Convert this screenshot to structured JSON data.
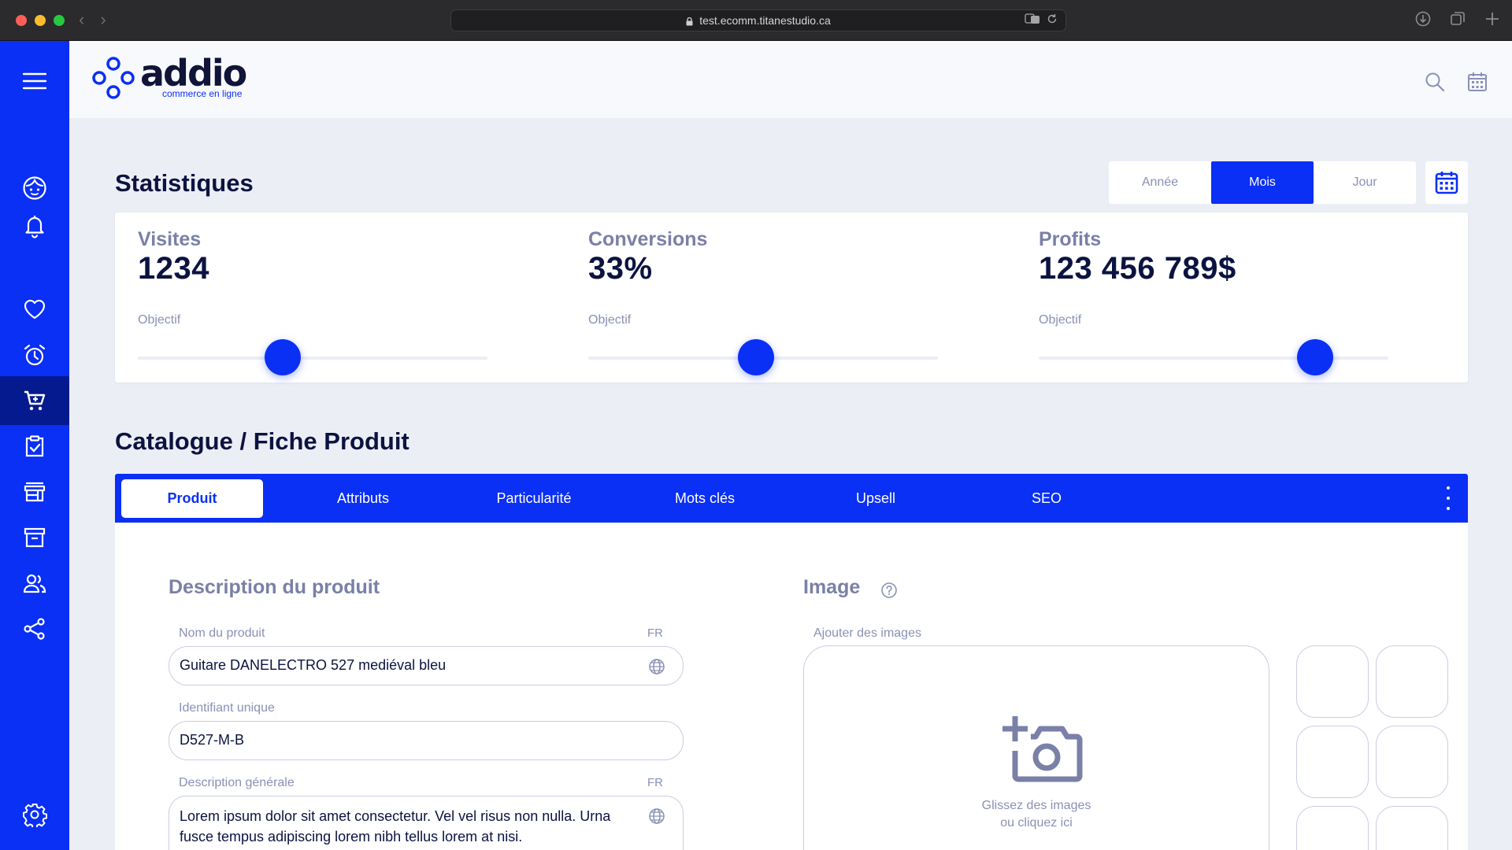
{
  "browser": {
    "url": "test.ecomm.titanestudio.ca"
  },
  "colors": {
    "accent": "#0a2ff5",
    "sidebar_active": "#061a8f",
    "text_dark": "#0b1340",
    "text_muted": "#7a80a7",
    "page_bg": "#eceef6"
  },
  "brand": {
    "name": "addio",
    "tagline": "commerce en ligne"
  },
  "sidebar": {
    "items": [
      {
        "icon": "menu-icon"
      },
      {
        "icon": "face-icon"
      },
      {
        "icon": "bell-icon"
      },
      {
        "icon": "heart-icon"
      },
      {
        "icon": "alarm-clock-icon"
      },
      {
        "icon": "shopping-cart-icon",
        "active": true
      },
      {
        "icon": "clipboard-check-icon"
      },
      {
        "icon": "store-icon"
      },
      {
        "icon": "archive-icon"
      },
      {
        "icon": "users-icon"
      },
      {
        "icon": "share-icon"
      },
      {
        "icon": "gear-icon"
      }
    ]
  },
  "header": {
    "tools": [
      "search-icon",
      "calendar-icon"
    ]
  },
  "stats": {
    "title": "Statistiques",
    "periods": [
      "Année",
      "Mois",
      "Jour"
    ],
    "selected_period": "Mois",
    "cards": [
      {
        "label": "Visites",
        "value": "1234",
        "objective_label": "Objectif",
        "objective_level": 0.415
      },
      {
        "label": "Conversions",
        "value": "33%",
        "objective_label": "Objectif",
        "objective_level": 0.48
      },
      {
        "label": "Profits",
        "value": "123 456 789$",
        "objective_label": "Objectif",
        "objective_level": 0.79
      }
    ]
  },
  "catalog": {
    "title": "Catalogue / Fiche Produit",
    "tabs": [
      "Produit",
      "Attributs",
      "Particularité",
      "Mots clés",
      "Upsell",
      "SEO"
    ],
    "active_tab": "Produit",
    "description": {
      "title": "Description du produit",
      "name_label": "Nom du produit",
      "name_lang": "FR",
      "name_value": "Guitare DANELECTRO 527 mediéval bleu",
      "id_label": "Identifiant unique",
      "id_value": "D527-M-B",
      "general_label": "Description générale",
      "general_lang": "FR",
      "general_value": "Lorem ipsum dolor sit amet consectetur. Vel vel risus non nulla. Urna fusce tempus adipiscing lorem nibh tellus lorem at nisi."
    },
    "image": {
      "title": "Image",
      "add_label": "Ajouter des images",
      "drop_line1": "Glissez des images",
      "drop_line2": "ou cliquez ici"
    }
  }
}
